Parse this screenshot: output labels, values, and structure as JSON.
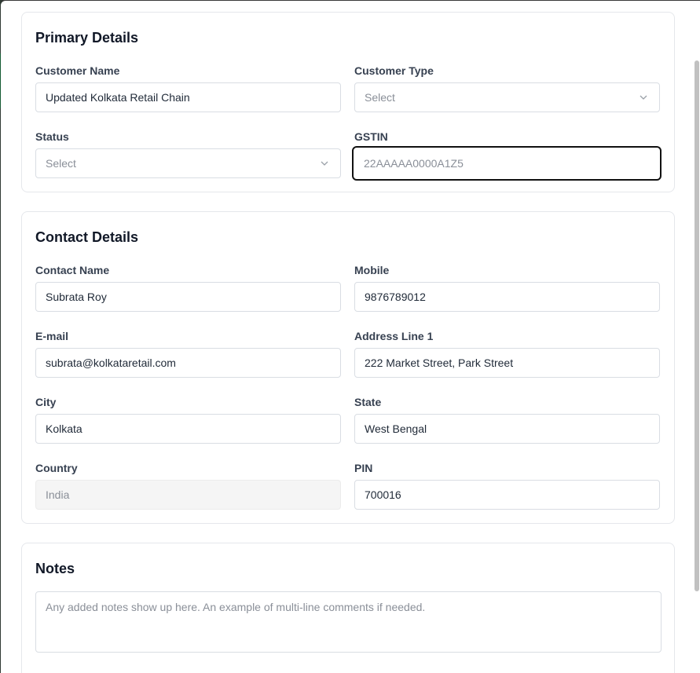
{
  "primary": {
    "title": "Primary Details",
    "customer_name": {
      "label": "Customer Name",
      "value": "Updated Kolkata Retail Chain"
    },
    "customer_type": {
      "label": "Customer Type",
      "placeholder": "Select"
    },
    "status": {
      "label": "Status",
      "placeholder": "Select"
    },
    "gstin": {
      "label": "GSTIN",
      "placeholder": "22AAAAA0000A1Z5"
    }
  },
  "contact": {
    "title": "Contact Details",
    "contact_name": {
      "label": "Contact Name",
      "value": "Subrata Roy"
    },
    "mobile": {
      "label": "Mobile",
      "value": "9876789012"
    },
    "email": {
      "label": "E-mail",
      "value": "subrata@kolkataretail.com"
    },
    "address1": {
      "label": "Address Line 1",
      "value": "222 Market Street, Park Street"
    },
    "city": {
      "label": "City",
      "value": "Kolkata"
    },
    "state": {
      "label": "State",
      "value": "West Bengal"
    },
    "country": {
      "label": "Country",
      "value": "India"
    },
    "pin": {
      "label": "PIN",
      "value": "700016"
    }
  },
  "notes": {
    "title": "Notes",
    "placeholder": "Any added notes show up here. An example of multi-line comments if needed."
  },
  "icons": {
    "select_chevron": "chevron-down-icon"
  }
}
